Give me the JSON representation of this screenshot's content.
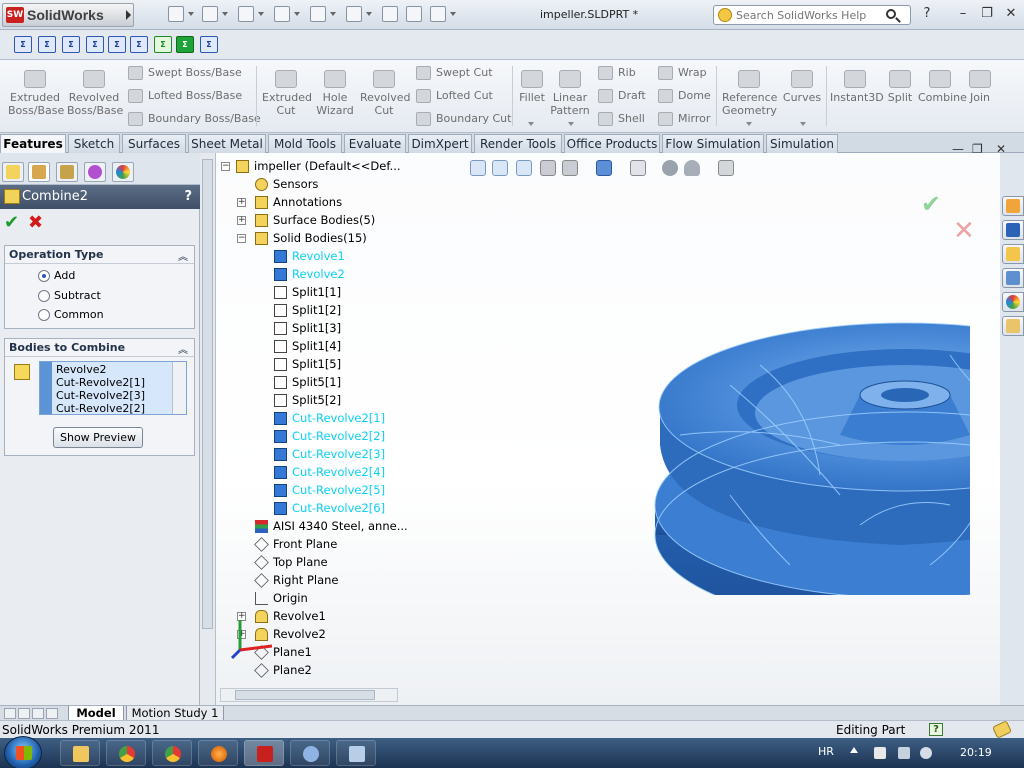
{
  "app": {
    "brand": "SolidWorks",
    "document_title": "impeller.SLDPRT *",
    "search_placeholder": "Search SolidWorks Help",
    "help_label": "?"
  },
  "toolrow": {
    "icons": [
      "Σ",
      "Σ",
      "Σ",
      "Σ",
      "Σ",
      "Σ",
      "Σ",
      "Σ",
      "Σ",
      "Σ"
    ]
  },
  "ribbon": {
    "extruded_boss": "Extruded Boss/Base",
    "revolved_boss": "Revolved Boss/Base",
    "swept_boss": "Swept Boss/Base",
    "lofted_boss": "Lofted Boss/Base",
    "boundary_boss": "Boundary Boss/Base",
    "extruded_cut": "Extruded Cut",
    "hole_wizard": "Hole Wizard",
    "revolved_cut": "Revolved Cut",
    "swept_cut": "Swept Cut",
    "lofted_cut": "Lofted Cut",
    "boundary_cut": "Boundary Cut",
    "fillet": "Fillet",
    "linear_pattern": "Linear Pattern",
    "rib": "Rib",
    "draft": "Draft",
    "shell": "Shell",
    "wrap": "Wrap",
    "dome": "Dome",
    "mirror": "Mirror",
    "reference_geometry": "Reference Geometry",
    "curves": "Curves",
    "instant3d": "Instant3D",
    "split": "Split",
    "combine": "Combine",
    "join": "Join"
  },
  "tabs": [
    "Features",
    "Sketch",
    "Surfaces",
    "Sheet Metal",
    "Mold Tools",
    "Evaluate",
    "DimXpert",
    "Render Tools",
    "Office Products",
    "Flow Simulation",
    "Simulation"
  ],
  "property_manager": {
    "title": "Combine2",
    "help": "?",
    "ok_symbol": "✔",
    "cancel_symbol": "✖",
    "operation_type": {
      "header": "Operation Type",
      "options": [
        "Add",
        "Subtract",
        "Common"
      ],
      "selected": "Add"
    },
    "bodies": {
      "header": "Bodies to Combine",
      "items": [
        "Revolve2",
        "Cut-Revolve2[1]",
        "Cut-Revolve2[3]",
        "Cut-Revolve2[2]"
      ],
      "show_preview": "Show Preview"
    }
  },
  "tree": {
    "root": "impeller  (Default<<Def...",
    "items": [
      "Sensors",
      "Annotations",
      "Surface Bodies(5)",
      "Solid Bodies(15)",
      "Revolve1",
      "Revolve2",
      "Split1[1]",
      "Split1[2]",
      "Split1[3]",
      "Split1[4]",
      "Split1[5]",
      "Split5[1]",
      "Split5[2]",
      "Cut-Revolve2[1]",
      "Cut-Revolve2[2]",
      "Cut-Revolve2[3]",
      "Cut-Revolve2[4]",
      "Cut-Revolve2[5]",
      "Cut-Revolve2[6]",
      "AISI 4340 Steel, anne...",
      "Front Plane",
      "Top Plane",
      "Right Plane",
      "Origin",
      "Revolve1",
      "Revolve2",
      "Plane1",
      "Plane2"
    ],
    "highlighted": [
      "Revolve1",
      "Revolve2",
      "Cut-Revolve2[1]",
      "Cut-Revolve2[2]",
      "Cut-Revolve2[3]",
      "Cut-Revolve2[4]",
      "Cut-Revolve2[5]",
      "Cut-Revolve2[6]"
    ]
  },
  "bottom_tabs": [
    "Model",
    "Motion Study 1"
  ],
  "status": {
    "left": "SolidWorks Premium 2011",
    "right": "Editing Part",
    "help": "?"
  },
  "taskbar": {
    "language": "HR",
    "time": "20:19"
  },
  "colors": {
    "highlight": "#0cd0f2",
    "model_fill": "#3d7fd0",
    "ok": "#1c9c2a",
    "cancel": "#d11a1a"
  }
}
